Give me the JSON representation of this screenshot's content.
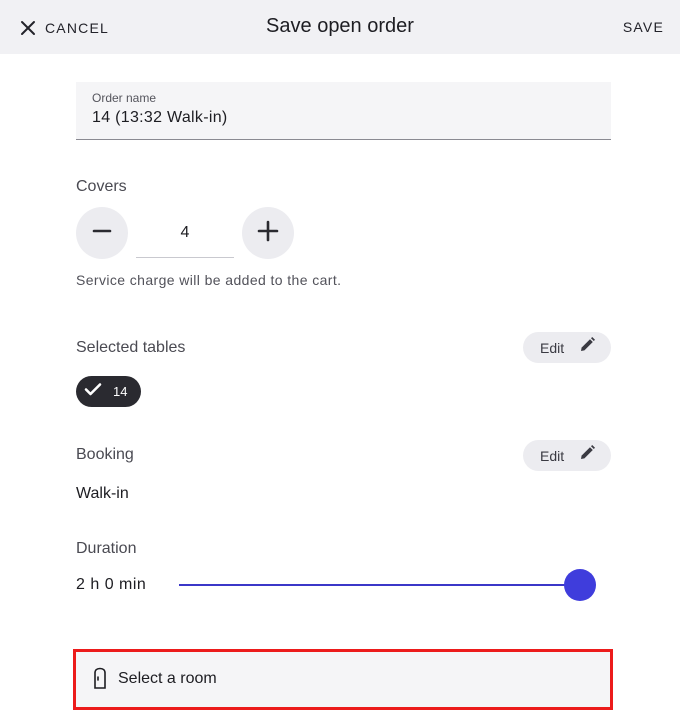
{
  "header": {
    "cancel_label": "CANCEL",
    "title": "Save open order",
    "save_label": "SAVE"
  },
  "order_name": {
    "label": "Order name",
    "value": "14 (13:32 Walk-in)"
  },
  "covers": {
    "label": "Covers",
    "value": "4",
    "hint": "Service charge will be added to the cart."
  },
  "tables": {
    "label": "Selected tables",
    "edit_label": "Edit",
    "selected": [
      "14"
    ]
  },
  "booking": {
    "label": "Booking",
    "edit_label": "Edit",
    "value": "Walk-in"
  },
  "duration": {
    "label": "Duration",
    "value": "2 h 0 min",
    "slider_fraction": 1.0
  },
  "room": {
    "label": "Select a room"
  },
  "colors": {
    "accent": "#3f3ddc",
    "highlight_border": "#ec1b1b",
    "chip_bg": "#2a2a30"
  }
}
